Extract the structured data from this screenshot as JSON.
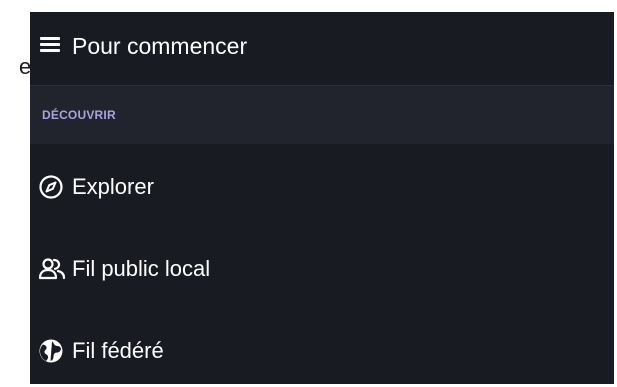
{
  "edge_fragment": "e",
  "header": {
    "menu_icon": "hamburger-menu-icon",
    "title": "Pour commencer"
  },
  "section": {
    "label": "DÉCOUVRIR"
  },
  "nav": [
    {
      "icon": "compass-icon",
      "label": "Explorer"
    },
    {
      "icon": "users-icon",
      "label": "Fil public local"
    },
    {
      "icon": "globe-icon",
      "label": "Fil fédéré"
    }
  ],
  "colors": {
    "panel_bg": "#191b22",
    "section_bg": "#22242d",
    "section_label": "#a8a4e0",
    "text": "#ffffff"
  }
}
